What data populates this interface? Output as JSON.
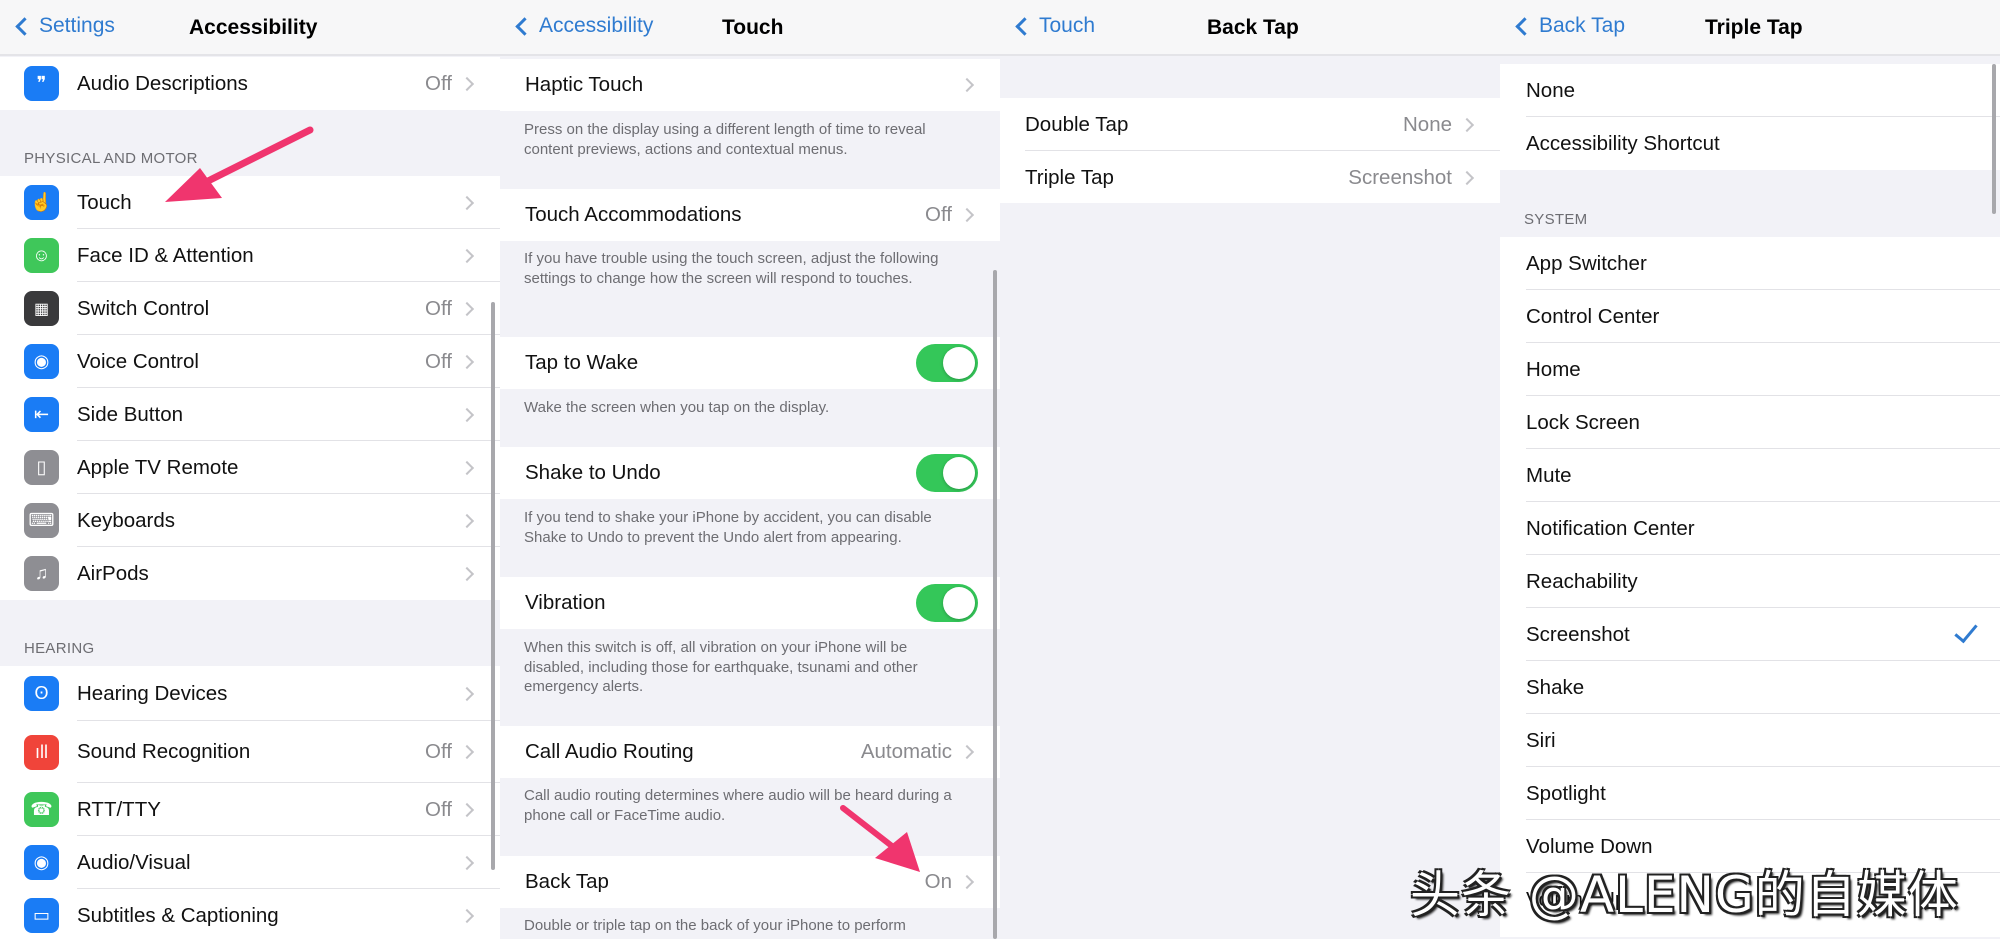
{
  "accent_color": "#2f7bd0",
  "toggle_on_color": "#34c759",
  "annotation_color": "#f0356e",
  "panels": {
    "accessibility": {
      "back_label": "Settings",
      "title": "Accessibility",
      "top_rows": [
        {
          "label": "Audio Descriptions",
          "value": "Off",
          "icon": "audio-descriptions-icon",
          "color": "#1a7cf5"
        }
      ],
      "sections": [
        {
          "header": "PHYSICAL AND MOTOR",
          "rows": [
            {
              "label": "Touch",
              "value": "",
              "icon": "touch-hand-icon",
              "color": "#1a7cf5"
            },
            {
              "label": "Face ID & Attention",
              "value": "",
              "icon": "face-id-icon",
              "color": "#3fc75a"
            },
            {
              "label": "Switch Control",
              "value": "Off",
              "icon": "switch-control-icon",
              "color": "#3a3a3c"
            },
            {
              "label": "Voice Control",
              "value": "Off",
              "icon": "voice-control-icon",
              "color": "#1a7cf5"
            },
            {
              "label": "Side Button",
              "value": "",
              "icon": "side-button-icon",
              "color": "#1a7cf5"
            },
            {
              "label": "Apple TV Remote",
              "value": "",
              "icon": "remote-icon",
              "color": "#8e8e93"
            },
            {
              "label": "Keyboards",
              "value": "",
              "icon": "keyboard-icon",
              "color": "#8e8e93"
            },
            {
              "label": "AirPods",
              "value": "",
              "icon": "airpods-icon",
              "color": "#8e8e93"
            }
          ]
        },
        {
          "header": "HEARING",
          "rows": [
            {
              "label": "Hearing Devices",
              "value": "",
              "icon": "ear-icon",
              "color": "#1a7cf5"
            },
            {
              "label": "Sound Recognition",
              "value": "Off",
              "icon": "sound-recognition-icon",
              "color": "#f0443a"
            },
            {
              "label": "RTT/TTY",
              "value": "Off",
              "icon": "tty-phone-icon",
              "color": "#3fc75a"
            },
            {
              "label": "Audio/Visual",
              "value": "",
              "icon": "audio-visual-icon",
              "color": "#1a7cf5"
            },
            {
              "label": "Subtitles & Captioning",
              "value": "",
              "icon": "subtitles-icon",
              "color": "#1a7cf5"
            }
          ]
        }
      ]
    },
    "touch": {
      "back_label": "Accessibility",
      "title": "Touch",
      "items": [
        {
          "label": "Haptic Touch",
          "value": "",
          "control": "chevron",
          "description": "Press on the display using a different length of time to reveal content previews, actions and contextual menus."
        },
        {
          "label": "Touch Accommodations",
          "value": "Off",
          "control": "chevron",
          "description": "If you have trouble using the touch screen, adjust the following settings to change how the screen will respond to touches."
        },
        {
          "label": "Tap to Wake",
          "value": "",
          "control": "toggle",
          "on": true,
          "description": "Wake the screen when you tap on the display."
        },
        {
          "label": "Shake to Undo",
          "value": "",
          "control": "toggle",
          "on": true,
          "description": "If you tend to shake your iPhone by accident, you can disable Shake to Undo to prevent the Undo alert from appearing."
        },
        {
          "label": "Vibration",
          "value": "",
          "control": "toggle",
          "on": true,
          "description": "When this switch is off, all vibration on your iPhone will be disabled, including those for earthquake, tsunami and other emergency alerts."
        },
        {
          "label": "Call Audio Routing",
          "value": "Automatic",
          "control": "chevron",
          "description": "Call audio routing determines where audio will be heard during a phone call or FaceTime audio."
        },
        {
          "label": "Back Tap",
          "value": "On",
          "control": "chevron",
          "description": "Double or triple tap on the back of your iPhone to perform"
        }
      ]
    },
    "back_tap": {
      "back_label": "Touch",
      "title": "Back Tap",
      "rows": [
        {
          "label": "Double Tap",
          "value": "None"
        },
        {
          "label": "Triple Tap",
          "value": "Screenshot"
        }
      ]
    },
    "triple_tap": {
      "back_label": "Back Tap",
      "title": "Triple Tap",
      "top_rows": [
        {
          "label": "None",
          "selected": false
        },
        {
          "label": "Accessibility Shortcut",
          "selected": false
        }
      ],
      "section_header": "SYSTEM",
      "system_rows": [
        {
          "label": "App Switcher",
          "selected": false
        },
        {
          "label": "Control Center",
          "selected": false
        },
        {
          "label": "Home",
          "selected": false
        },
        {
          "label": "Lock Screen",
          "selected": false
        },
        {
          "label": "Mute",
          "selected": false
        },
        {
          "label": "Notification Center",
          "selected": false
        },
        {
          "label": "Reachability",
          "selected": false
        },
        {
          "label": "Screenshot",
          "selected": true
        },
        {
          "label": "Shake",
          "selected": false
        },
        {
          "label": "Siri",
          "selected": false
        },
        {
          "label": "Spotlight",
          "selected": false
        },
        {
          "label": "Volume Down",
          "selected": false
        },
        {
          "label": "Volume Up",
          "selected": false
        }
      ]
    }
  },
  "watermark": "头条 @ALENG的自媒体"
}
